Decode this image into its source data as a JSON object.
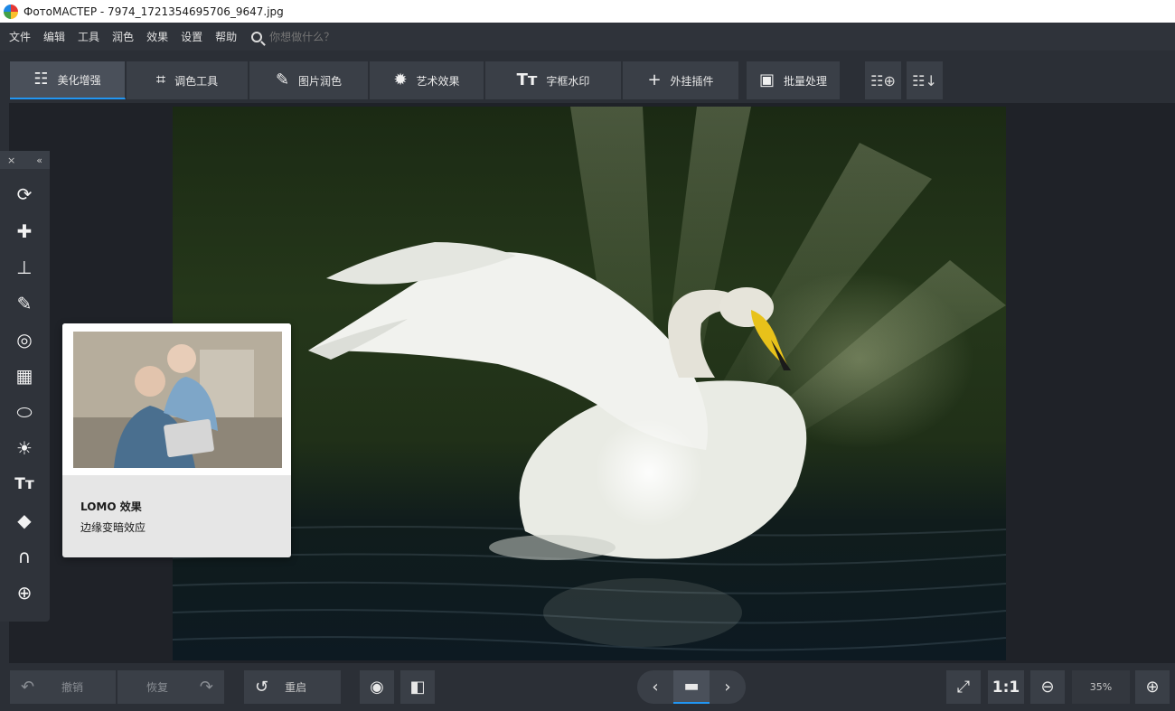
{
  "window": {
    "title": "ФотоМАСТЕР - 7974_1721354695706_9647.jpg"
  },
  "menu": {
    "items": [
      "文件",
      "编辑",
      "工具",
      "润色",
      "效果",
      "设置",
      "帮助"
    ],
    "search_placeholder": "你想做什么？"
  },
  "tabs": [
    {
      "label": "美化增强",
      "icon": "sliders-icon",
      "active": true
    },
    {
      "label": "调色工具",
      "icon": "crop-icon"
    },
    {
      "label": "图片润色",
      "icon": "brush-icon"
    },
    {
      "label": "艺术效果",
      "icon": "magic-wand-icon"
    },
    {
      "label": "字框水印",
      "icon": "text-icon"
    },
    {
      "label": "外挂插件",
      "icon": "plus-icon"
    },
    {
      "label": "批量处理",
      "icon": "gallery-icon"
    }
  ],
  "left_toolbar": {
    "header_close": "×",
    "header_collapse": "«",
    "tools": [
      "rotate-crop-icon",
      "healing-icon",
      "stamp-icon",
      "brush-icon",
      "radial-icon",
      "gradient-icon",
      "vignette-icon",
      "light-icon",
      "text-icon",
      "fill-icon",
      "curve-icon",
      "sphere-icon"
    ]
  },
  "tooltip": {
    "title": "LOMO 效果",
    "description": "边缘变暗效应"
  },
  "bottom": {
    "undo_label": "撤销",
    "redo_label": "恢复",
    "reset_label": "重启",
    "ratio_label": "1:1",
    "zoom_value": "35%"
  }
}
